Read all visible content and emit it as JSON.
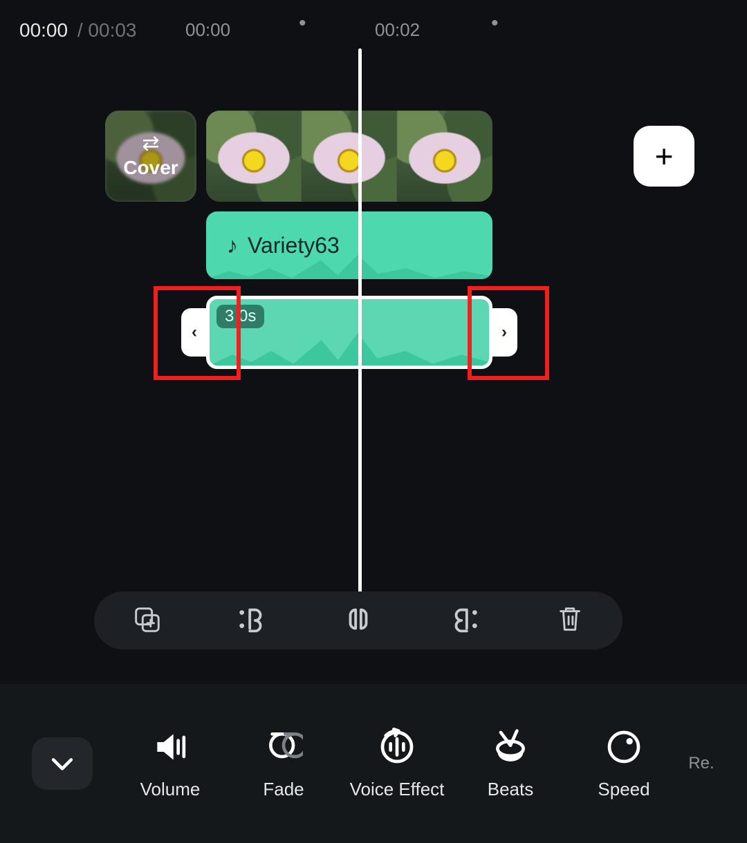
{
  "timeline": {
    "current": "00:00",
    "duration": "00:03",
    "ticks": [
      "00:00",
      "00:02"
    ]
  },
  "cover_label": "Cover",
  "audio_track": {
    "name": "Variety63"
  },
  "selected_clip": {
    "length_label": "3 0s"
  },
  "highlights": {
    "left": true,
    "right": true
  },
  "clip_actions": {
    "duplicate": "Duplicate",
    "trim_in": "Trim In",
    "split": "Split",
    "trim_out": "Trim Out",
    "delete": "Delete"
  },
  "tools": {
    "collapse": "Collapse",
    "volume": "Volume",
    "fade": "Fade",
    "voice_effect": "Voice Effect",
    "beats": "Beats",
    "speed": "Speed",
    "more_cut": "Re."
  },
  "add_clip_label": "+"
}
